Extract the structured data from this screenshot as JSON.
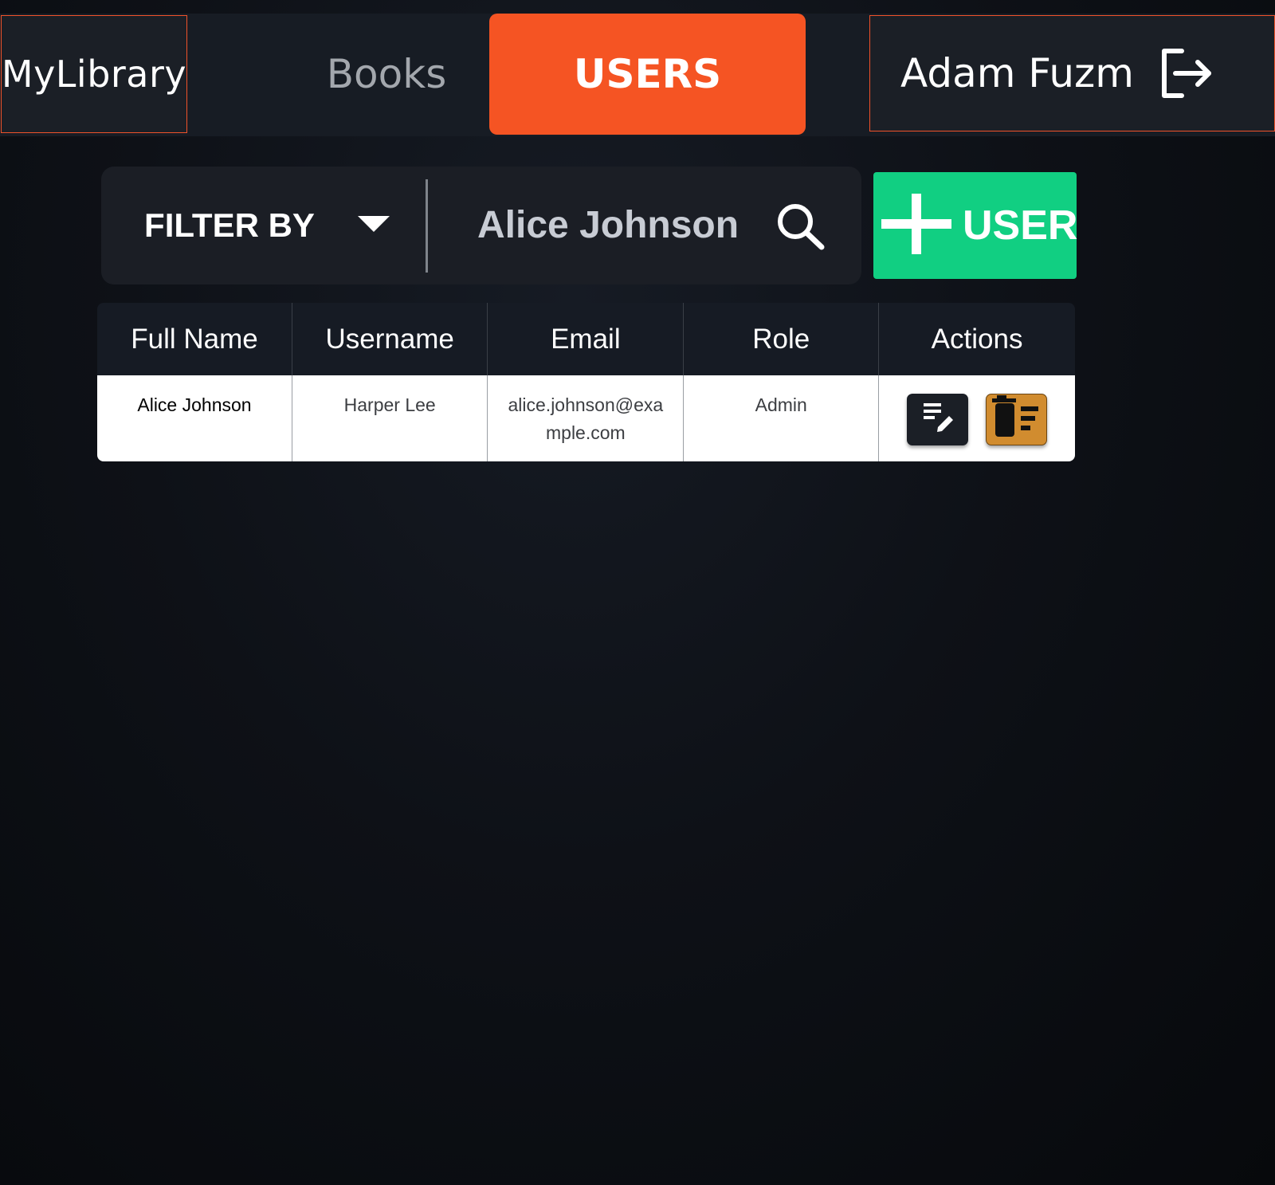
{
  "nav": {
    "brand": "MyLibrary",
    "tabs": [
      {
        "label": "Books",
        "active": false
      },
      {
        "label": "USERS",
        "active": true
      }
    ],
    "user_name": "Adam Fuzm",
    "logout_icon": "logout-icon",
    "active_color": "#f55423",
    "border_color": "#f0522a"
  },
  "toolbar": {
    "filter_label": "FILTER BY",
    "filter_icon": "caret-down-icon",
    "search_value": "Alice Johnson",
    "search_icon": "search-icon",
    "add_user_label": "USER",
    "add_user_icon": "plus-icon",
    "add_user_color": "#11cf82"
  },
  "table": {
    "columns": [
      "Full Name",
      "Username",
      "Email",
      "Role",
      "Actions"
    ],
    "rows": [
      {
        "full_name": "Alice Johnson",
        "username": "Harper Lee",
        "email": "alice.johnson@example.com",
        "role": "Admin",
        "actions": [
          "edit-icon",
          "delete-icon"
        ]
      }
    ]
  }
}
